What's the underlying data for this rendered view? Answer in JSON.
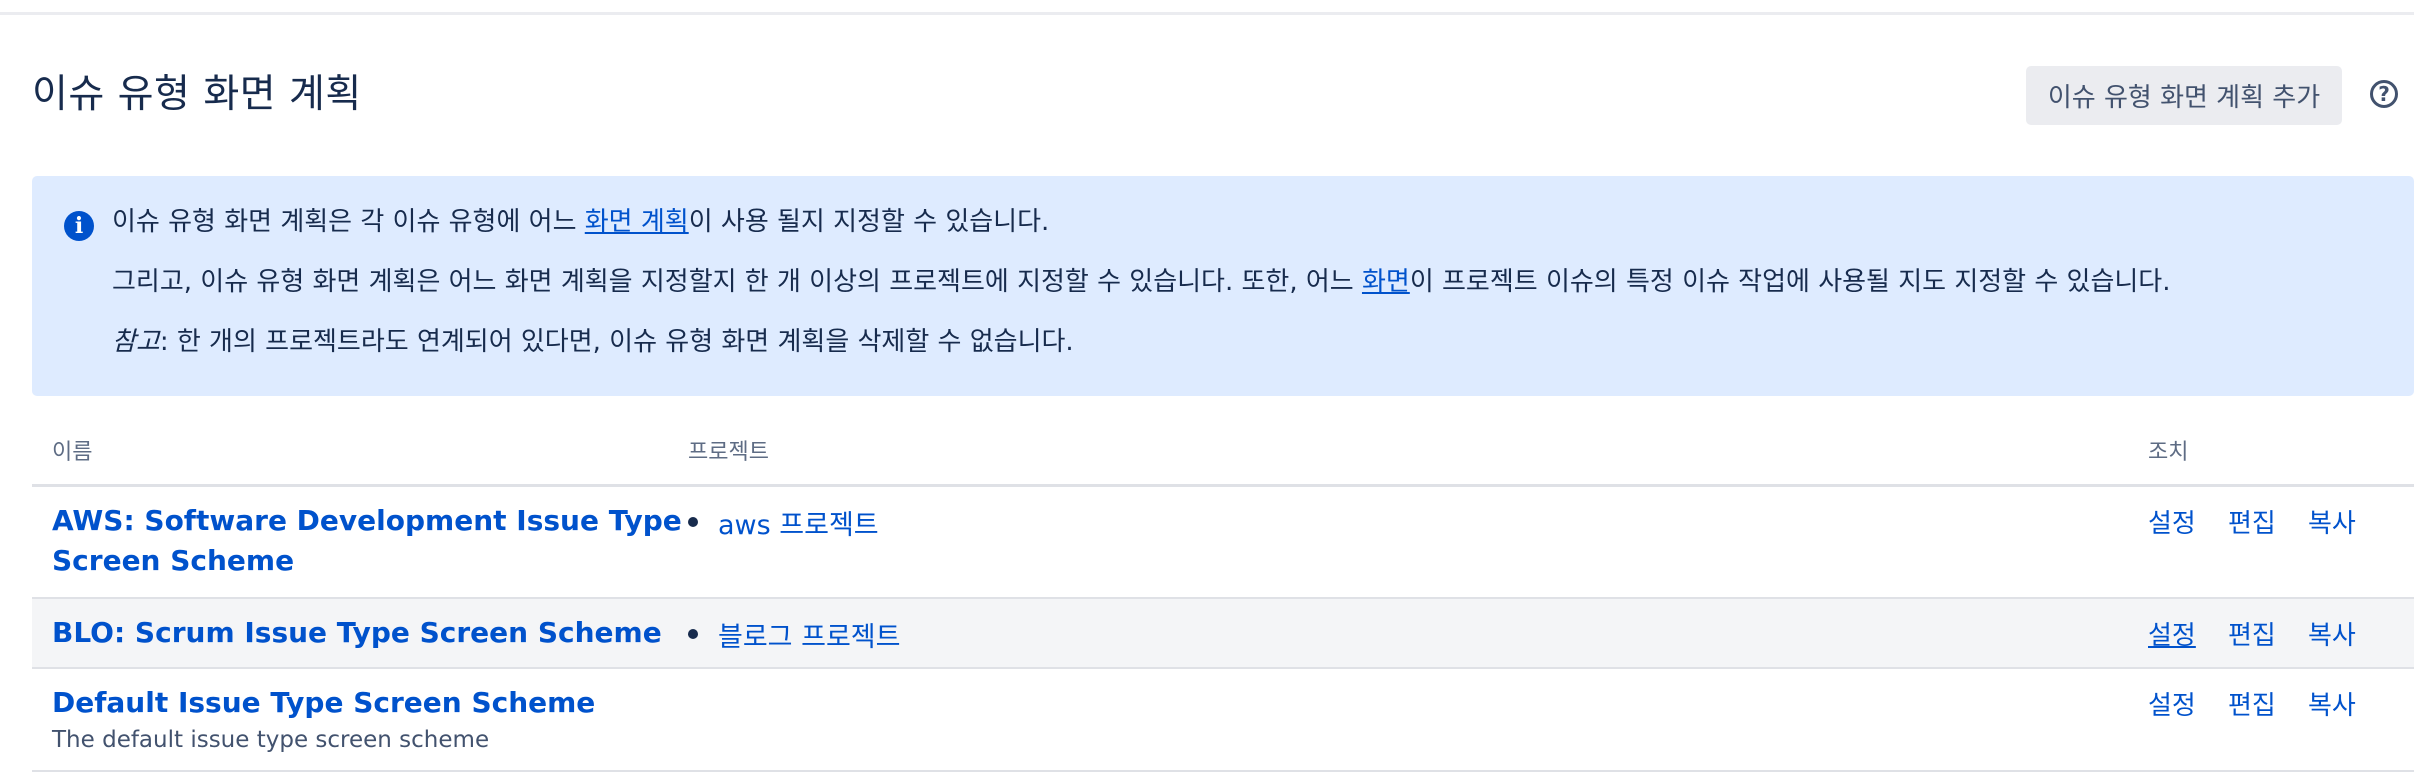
{
  "page": {
    "title": "이슈 유형 화면 계획",
    "add_button_label": "이슈 유형 화면 계획 추가",
    "help_icon": "question-circle-icon"
  },
  "info": {
    "icon": "info-circle-icon",
    "line1_pre": "이슈 유형 화면 계획은 각 이슈 유형에 어느 ",
    "line1_link": "화면 계획",
    "line1_post": "이 사용 될지 지정할 수 있습니다.",
    "line2_pre": "그리고, 이슈 유형 화면 계획은 어느 화면 계획을 지정할지 한 개 이상의 프로젝트에 지정할 수 있습니다. 또한, 어느 ",
    "line2_link": "화면",
    "line2_post": "이 프로젝트 이슈의 특정 이슈 작업에 사용될 지도 지정할 수 있습니다.",
    "line3_em": "참고",
    "line3_rest": ": 한 개의 프로젝트라도 연계되어 있다면, 이슈 유형 화면 계획을 삭제할 수 없습니다."
  },
  "table": {
    "columns": {
      "name": "이름",
      "projects": "프로젝트",
      "actions": "조치"
    },
    "rows": [
      {
        "name_line1": "AWS: Software Development Issue Type",
        "name_line2": "Screen Scheme",
        "description": "",
        "project": "aws 프로젝트",
        "actions": {
          "configure": "설정",
          "edit": "편집",
          "copy": "복사"
        }
      },
      {
        "name_line1": "BLO: Scrum Issue Type Screen Scheme",
        "description": "",
        "project": "블로그 프로젝트",
        "actions": {
          "configure": "설정",
          "edit": "편집",
          "copy": "복사"
        }
      },
      {
        "name_line1": "Default Issue Type Screen Scheme",
        "description": "The default issue type screen scheme",
        "project": "",
        "actions": {
          "configure": "설정",
          "edit": "편집",
          "copy": "복사"
        }
      }
    ]
  },
  "colors": {
    "link": "#0052cc",
    "text": "#172b4d",
    "info_bg": "#deebff",
    "button_bg": "#ebecf0",
    "row_hover_bg": "#f4f5f7"
  }
}
